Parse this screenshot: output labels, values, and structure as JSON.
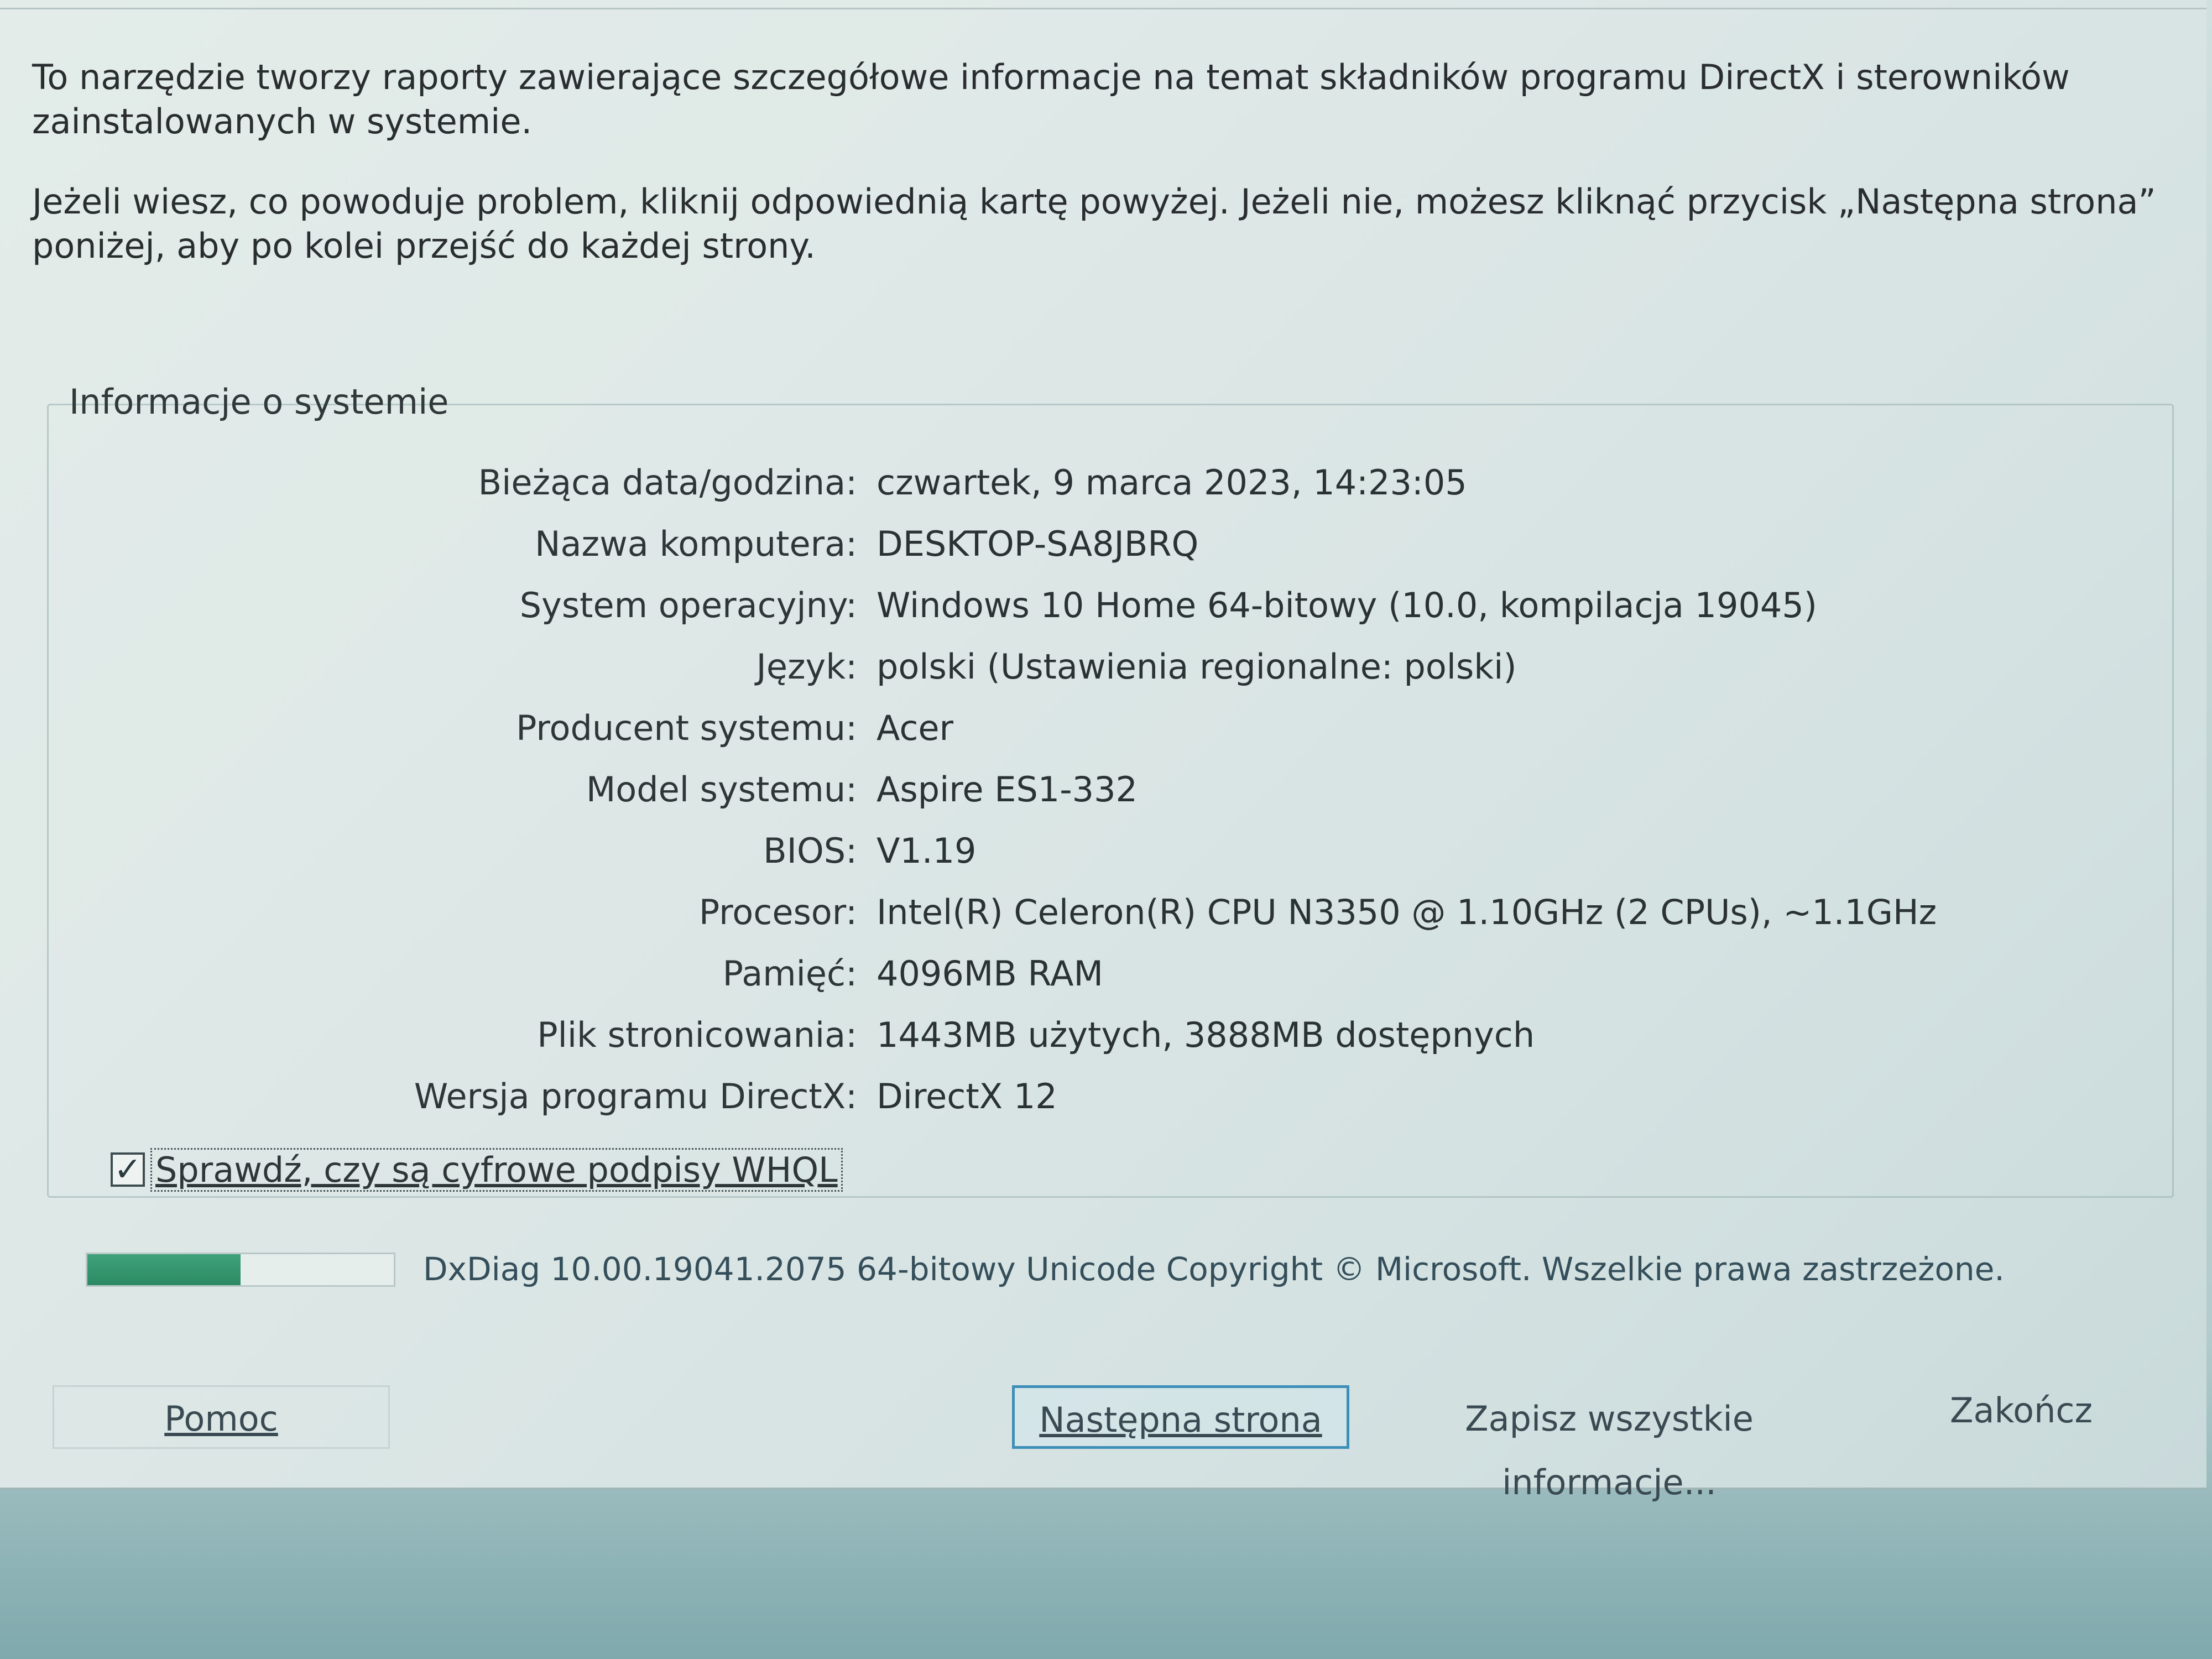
{
  "intro": {
    "line1": "To narzędzie tworzy raporty zawierające szczegółowe informacje na temat składników programu DirectX i sterowników zainstalowanych w systemie.",
    "line2": "Jeżeli wiesz, co powoduje problem, kliknij odpowiednią kartę powyżej. Jeżeli nie, możesz kliknąć przycisk „Następna strona” poniżej, aby po kolei przejść do każdej strony."
  },
  "system_info": {
    "title": "Informacje o systemie",
    "rows": [
      {
        "label": "Bieżąca data/godzina:",
        "value": "czwartek, 9 marca 2023, 14:23:05"
      },
      {
        "label": "Nazwa komputera:",
        "value": "DESKTOP-SA8JBRQ"
      },
      {
        "label": "System operacyjny:",
        "value": "Windows 10 Home 64-bitowy (10.0, kompilacja 19045)"
      },
      {
        "label": "Język:",
        "value": "polski (Ustawienia regionalne: polski)"
      },
      {
        "label": "Producent systemu:",
        "value": "Acer"
      },
      {
        "label": "Model systemu:",
        "value": "Aspire ES1-332"
      },
      {
        "label": "BIOS:",
        "value": "V1.19"
      },
      {
        "label": "Procesor:",
        "value": "Intel(R) Celeron(R) CPU N3350 @ 1.10GHz (2 CPUs), ~1.1GHz"
      },
      {
        "label": "Pamięć:",
        "value": "4096MB RAM"
      },
      {
        "label": "Plik stronicowania:",
        "value": "1443MB użytych, 3888MB dostępnych"
      },
      {
        "label": "Wersja programu DirectX:",
        "value": "DirectX 12"
      }
    ]
  },
  "whql": {
    "label": "Sprawdź, czy są cyfrowe podpisy WHQL",
    "checked": true
  },
  "progress": {
    "fraction": 0.5
  },
  "footer": {
    "copyright": "DxDiag 10.00.19041.2075 64-bitowy Unicode  Copyright © Microsoft. Wszelkie prawa zastrzeżone."
  },
  "buttons": {
    "help_label": "Pomoc",
    "next_label": "Następna strona",
    "save_label": "Zapisz wszystkie informacje...",
    "exit_label": "Zakończ"
  },
  "colors": {
    "focus_border": "#3e8fb8",
    "progress_fill": "#2c8a63"
  }
}
